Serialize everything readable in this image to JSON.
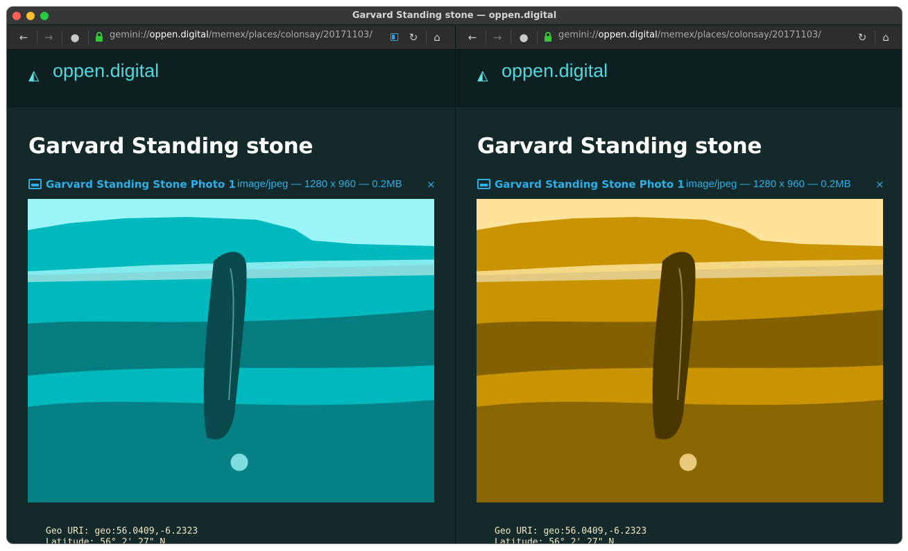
{
  "window": {
    "title": "Garvard Standing stone — oppen.digital"
  },
  "toolbar": {
    "back_icon": "arrow-left-icon",
    "forward_icon": "arrow-right-icon",
    "identity_icon": "person-icon",
    "lock_icon": "lock-icon",
    "url_scheme": "gemini://",
    "url_host": "oppen.digital",
    "url_path": "/memex/places/colonsay/20171103/",
    "sidebar_icon": "sidebar-icon",
    "reload_icon": "reload-icon",
    "home_icon": "home-icon"
  },
  "site": {
    "name": "oppen.digital",
    "logo_icon": "triangle-logo-icon"
  },
  "page": {
    "heading": "Garvard Standing stone",
    "image_link": {
      "title": "Garvard Standing Stone Photo 1",
      "meta": "image/jpeg — 1280 x 960 — 0.2MB",
      "close": "×"
    },
    "geo_uri_line": "Geo URI: geo:56.0409,-6.2323",
    "latitude_line": "Latitude: 56° 2' 27\" N"
  },
  "panes": [
    {
      "tint": "#00b9bf",
      "light": "#9bf4f6",
      "dark": "#0a4a4c"
    },
    {
      "tint": "#c99400",
      "light": "#ffe39a",
      "dark": "#4a3700"
    }
  ]
}
